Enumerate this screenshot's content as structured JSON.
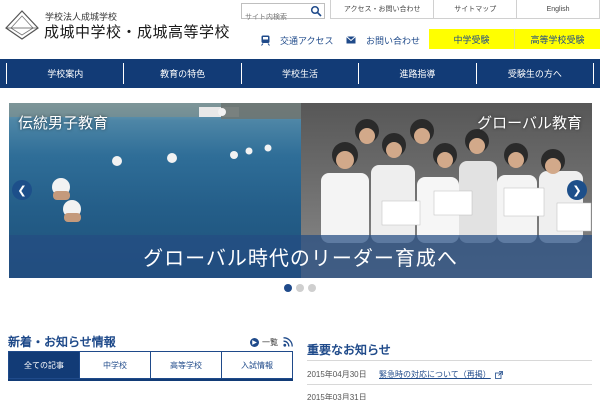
{
  "header": {
    "school_sub": "学校法人成城学校",
    "school_name": "成城中学校・成城高等学校",
    "logo_icon": "school-emblem-icon",
    "search": {
      "placeholder": "サイト内検索",
      "icon": "search-icon"
    },
    "top_links": [
      "アクセス・お問い合わせ",
      "サイトマップ",
      "English"
    ],
    "quick_links": [
      {
        "label": "交通アクセス",
        "icon": "train-icon"
      },
      {
        "label": "お問い合わせ",
        "icon": "mail-icon"
      }
    ],
    "yellow_buttons": [
      "中学受験",
      "高等学校受験"
    ],
    "yellow_color": "#ffff00"
  },
  "nav": {
    "items": [
      "学校案内",
      "教育の特色",
      "学校生活",
      "進路指導",
      "受験生の方へ"
    ],
    "color": "#123b76"
  },
  "hero": {
    "caption_left": "伝統男子教育",
    "caption_right": "グローバル教育",
    "banner": "グローバル時代のリーダー育成へ",
    "prev_icon": "chevron-left-icon",
    "next_icon": "chevron-right-icon",
    "slide_count": 3,
    "active_slide": 1
  },
  "news_tabs": {
    "title": "新着・お知らせ情報",
    "list_link": "一覧",
    "list_icon": "arrow-right-circle-icon",
    "rss_icon": "rss-icon",
    "tabs": [
      "全ての記事",
      "中学校",
      "高等学校",
      "入試情報"
    ],
    "active_tab": 0
  },
  "notices": {
    "title": "重要なお知らせ",
    "items": [
      {
        "date": "2015年04月30日",
        "text": "緊急時の対応について（再掲）"
      },
      {
        "date": "2015年03月31日",
        "text": ""
      }
    ]
  }
}
